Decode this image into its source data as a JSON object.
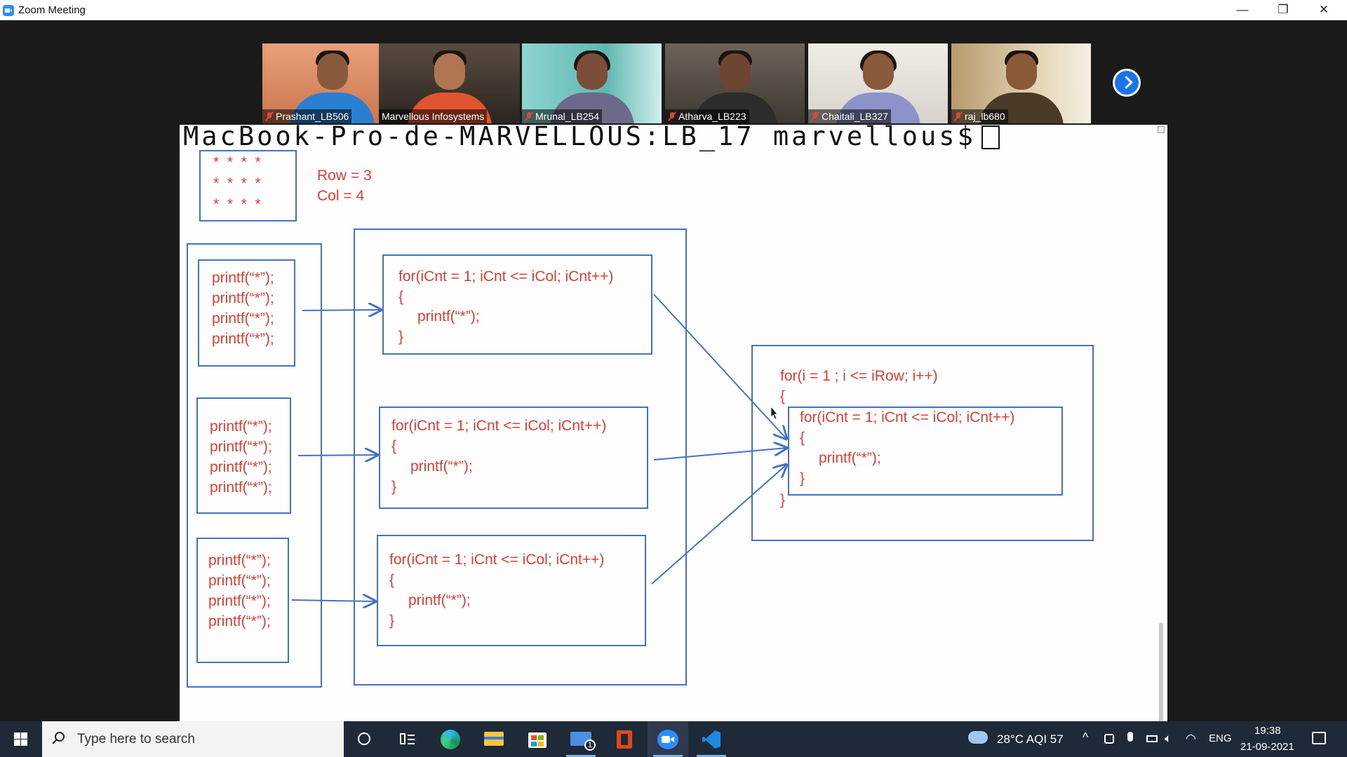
{
  "window": {
    "title": "Zoom Meeting",
    "minimize": "—",
    "restore": "❐",
    "close": "✕"
  },
  "participants": [
    {
      "name": "Prashant_LB506",
      "muted": true
    },
    {
      "name": "Marvellous Infosystems",
      "muted": false,
      "active": true
    },
    {
      "name": "Mrunal_LB254",
      "muted": true
    },
    {
      "name": "Atharva_LB223",
      "muted": true
    },
    {
      "name": "Chaitali_LB327",
      "muted": true
    },
    {
      "name": "raj_lb680",
      "muted": true
    }
  ],
  "terminal": {
    "prompt": "MacBook-Pro-de-MARVELLOUS:LB_17 marvellous$"
  },
  "slide": {
    "stars": [
      "*  *  *  *",
      "*  *  *  *",
      "*  *  *  *"
    ],
    "row_text": "Row = 3",
    "col_text": "Col = 4",
    "printf_line": "printf(“*”);",
    "inner_loop": {
      "head": "for(iCnt = 1; iCnt <= iCol; iCnt++)",
      "open": "{",
      "body": "printf(“*”);",
      "close": "}"
    },
    "outer_loop": {
      "head": "for(i = 1 ; i <= iRow; i++)",
      "open": "{",
      "close": "}"
    }
  },
  "taskbar": {
    "search_placeholder": "Type here to search",
    "weather": "28°C  AQI 57",
    "language": "ENG",
    "time": "19:38",
    "date": "21-09-2021",
    "mail_badge": "1"
  },
  "colors": {
    "diagram_box": "#4472c4",
    "code_text": "#e03c31",
    "zoom_blue": "#2d8cff",
    "taskbar": "#1f2a38"
  }
}
